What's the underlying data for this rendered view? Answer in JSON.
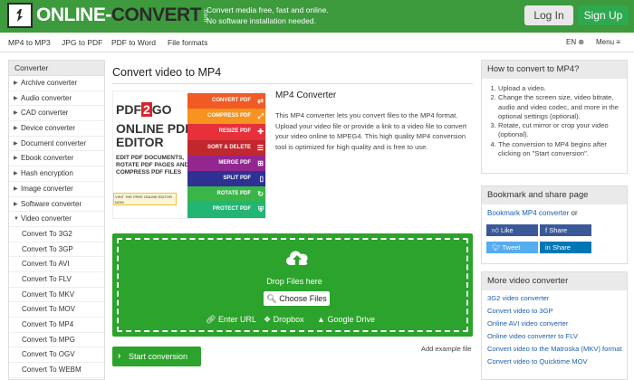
{
  "header": {
    "logo_text_a": "ONLINE-",
    "logo_text_b": "CONVERT",
    "logo_com": ".com",
    "tagline_1": "Convert media free, fast and online.",
    "tagline_2": "No software installation needed.",
    "login": "Log In",
    "signup": "Sign Up"
  },
  "nav": {
    "links": [
      "MP4 to MP3",
      "JPG to PDF",
      "PDF to Word",
      "File formats"
    ],
    "lang": "EN ⊕",
    "menu": "Menu ≡"
  },
  "sidebar": {
    "title": "Converter",
    "items": [
      "Archive converter",
      "Audio converter",
      "CAD converter",
      "Device converter",
      "Document converter",
      "Ebook converter",
      "Hash encryption",
      "Image converter",
      "Software converter",
      "Video converter"
    ],
    "subitems": [
      "Convert To 3G2",
      "Convert To 3GP",
      "Convert To AVI",
      "Convert To FLV",
      "Convert To MKV",
      "Convert To MOV",
      "Convert To MP4",
      "Convert To MPG",
      "Convert To OGV",
      "Convert To WEBM"
    ]
  },
  "main": {
    "title": "Convert video to MP4",
    "converter_title": "MP4 Converter",
    "description": "This MP4 converter lets you convert files to the MP4 format. Upload your video file or provide a link to a video file to convert your video online to MPEG4. This high quality MP4 conversion tool is optimized for high quality and is free to use.",
    "drop_text": "Drop Files here",
    "choose_files": "Choose Files",
    "enter_url": "Enter URL",
    "dropbox": "Dropbox",
    "google_drive": "Google Drive",
    "start": "Start conversion",
    "add_example": "Add example file"
  },
  "ad": {
    "logo_a": "PDF",
    "logo_b": "2",
    "logo_c": "GO",
    "big": "ONLINE PDF EDITOR",
    "small": "EDIT PDF DOCUMENTS, ROTATE PDF PAGES AND COMPRESS PDF FILES",
    "try": "VISIT THE FREE ONLINE EDITOR NOW",
    "adchoice": "▷ ✕",
    "rows": [
      {
        "label": "CONVERT PDF",
        "color": "#f15a24",
        "icon": "⇄"
      },
      {
        "label": "COMPRESS PDF",
        "color": "#f7931e",
        "icon": "⤢"
      },
      {
        "label": "RESIZE PDF",
        "color": "#e6303a",
        "icon": "✚"
      },
      {
        "label": "SORT & DELETE",
        "color": "#c1272d",
        "icon": "☰"
      },
      {
        "label": "MERGE PDF",
        "color": "#93278f",
        "icon": "⊞"
      },
      {
        "label": "SPLIT PDF",
        "color": "#2e3192",
        "icon": "▯"
      },
      {
        "label": "ROTATE PDF",
        "color": "#39b54a",
        "icon": "↻"
      },
      {
        "label": "PROTECT PDF",
        "color": "#22b573",
        "icon": "⛨"
      }
    ]
  },
  "how": {
    "title": "How to convert to MP4?",
    "steps": [
      "Upload a video.",
      "Change the screen size, video bitrate, audio and video codec, and more in the optional settings (optional).",
      "Rotate, cut mirror or crop your video (optional).",
      "The conversion to MP4 begins after clicking on \"Start conversion\"."
    ]
  },
  "bookmark": {
    "title": "Bookmark and share page",
    "link": "Bookmark MP4 converter",
    "or": " or",
    "like": "Like",
    "share_fb": "Share",
    "tweet": "Tweet",
    "share_in": "Share"
  },
  "more": {
    "title": "More video converter",
    "items": [
      "3G2 video converter",
      "Convert video to 3GP",
      "Online AVI video converter",
      "Online video converter to FLV",
      "Convert video to the Matroska (MKV) format",
      "Convert video to Quicktime MOV"
    ]
  },
  "colors": {
    "brand_green": "#3d9a3d",
    "drop_green": "#2ca32c",
    "link_blue": "#1a5fb0",
    "facebook": "#3b5998",
    "twitter": "#55acee",
    "linkedin": "#0077b5"
  }
}
